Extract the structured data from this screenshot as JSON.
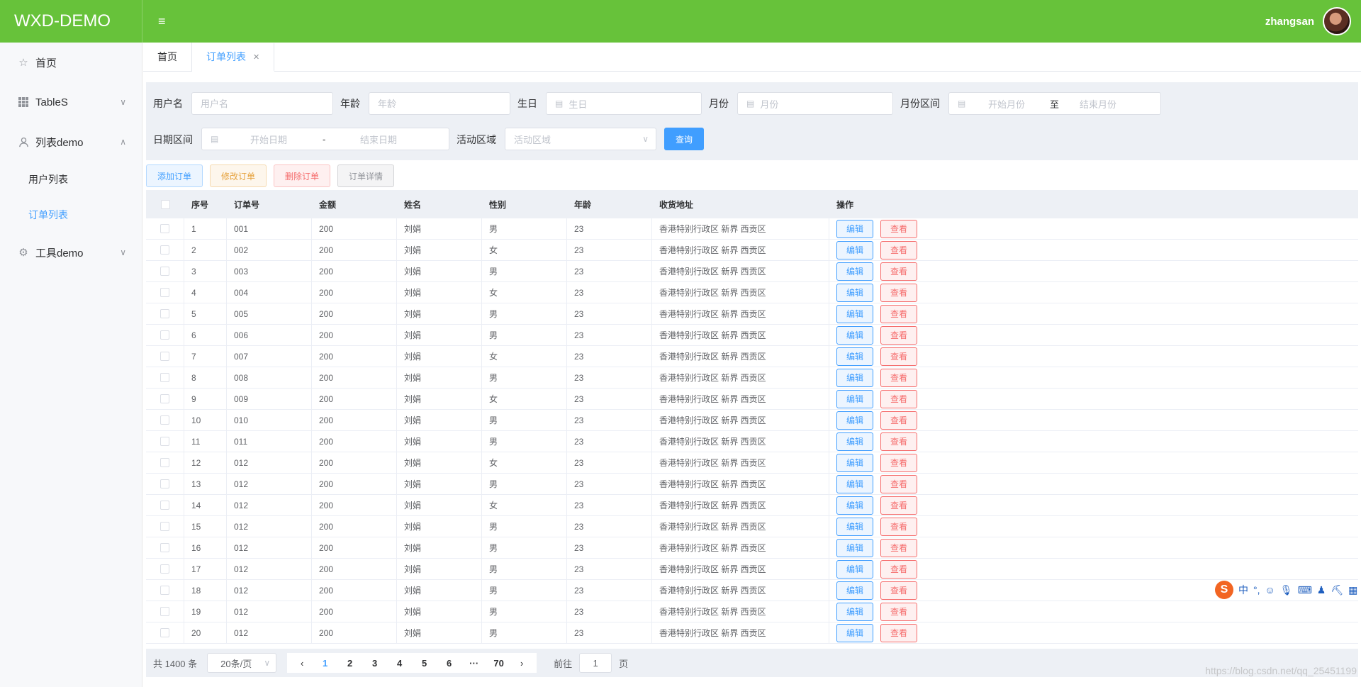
{
  "app": {
    "title": "WXD-DEMO",
    "username": "zhangsan"
  },
  "sidebar": {
    "items": [
      {
        "label": "首页",
        "icon": "star-icon"
      },
      {
        "label": "TableS",
        "icon": "grid-icon"
      },
      {
        "label": "列表demo",
        "icon": "user-icon"
      },
      {
        "label": "工具demo",
        "icon": "gear-icon"
      }
    ],
    "sub": [
      "用户列表",
      "订单列表"
    ]
  },
  "tabs": [
    "首页",
    "订单列表"
  ],
  "search": {
    "username_label": "用户名",
    "username_ph": "用户名",
    "age_label": "年龄",
    "age_ph": "年龄",
    "birthday_label": "生日",
    "birthday_ph": "生日",
    "month_label": "月份",
    "month_ph": "月份",
    "month_range_label": "月份区间",
    "month_start": "开始月份",
    "month_sep": "至",
    "month_end": "结束月份",
    "date_range_label": "日期区间",
    "date_start": "开始日期",
    "date_sep": "-",
    "date_end": "结束日期",
    "area_label": "活动区域",
    "area_ph": "活动区域",
    "query": "查询"
  },
  "actions": {
    "add": "添加订单",
    "edit": "修改订单",
    "delete": "删除订单",
    "detail": "订单详情"
  },
  "table": {
    "columns": [
      "序号",
      "订单号",
      "金额",
      "姓名",
      "性别",
      "年龄",
      "收货地址",
      "操作"
    ],
    "edit_btn": "编辑",
    "view_btn": "查看",
    "rows": [
      [
        "1",
        "001",
        "200",
        "刘娟",
        "男",
        "23",
        "香港特别行政区 新界 西贡区"
      ],
      [
        "2",
        "002",
        "200",
        "刘娟",
        "女",
        "23",
        "香港特别行政区 新界 西贡区"
      ],
      [
        "3",
        "003",
        "200",
        "刘娟",
        "男",
        "23",
        "香港特别行政区 新界 西贡区"
      ],
      [
        "4",
        "004",
        "200",
        "刘娟",
        "女",
        "23",
        "香港特别行政区 新界 西贡区"
      ],
      [
        "5",
        "005",
        "200",
        "刘娟",
        "男",
        "23",
        "香港特别行政区 新界 西贡区"
      ],
      [
        "6",
        "006",
        "200",
        "刘娟",
        "男",
        "23",
        "香港特别行政区 新界 西贡区"
      ],
      [
        "7",
        "007",
        "200",
        "刘娟",
        "女",
        "23",
        "香港特别行政区 新界 西贡区"
      ],
      [
        "8",
        "008",
        "200",
        "刘娟",
        "男",
        "23",
        "香港特别行政区 新界 西贡区"
      ],
      [
        "9",
        "009",
        "200",
        "刘娟",
        "女",
        "23",
        "香港特别行政区 新界 西贡区"
      ],
      [
        "10",
        "010",
        "200",
        "刘娟",
        "男",
        "23",
        "香港特别行政区 新界 西贡区"
      ],
      [
        "11",
        "011",
        "200",
        "刘娟",
        "男",
        "23",
        "香港特别行政区 新界 西贡区"
      ],
      [
        "12",
        "012",
        "200",
        "刘娟",
        "女",
        "23",
        "香港特别行政区 新界 西贡区"
      ],
      [
        "13",
        "012",
        "200",
        "刘娟",
        "男",
        "23",
        "香港特别行政区 新界 西贡区"
      ],
      [
        "14",
        "012",
        "200",
        "刘娟",
        "女",
        "23",
        "香港特别行政区 新界 西贡区"
      ],
      [
        "15",
        "012",
        "200",
        "刘娟",
        "男",
        "23",
        "香港特别行政区 新界 西贡区"
      ],
      [
        "16",
        "012",
        "200",
        "刘娟",
        "男",
        "23",
        "香港特别行政区 新界 西贡区"
      ],
      [
        "17",
        "012",
        "200",
        "刘娟",
        "男",
        "23",
        "香港特别行政区 新界 西贡区"
      ],
      [
        "18",
        "012",
        "200",
        "刘娟",
        "男",
        "23",
        "香港特别行政区 新界 西贡区"
      ],
      [
        "19",
        "012",
        "200",
        "刘娟",
        "男",
        "23",
        "香港特别行政区 新界 西贡区"
      ],
      [
        "20",
        "012",
        "200",
        "刘娟",
        "男",
        "23",
        "香港特别行政区 新界 西贡区"
      ]
    ]
  },
  "pagination": {
    "total": "共 1400 条",
    "page_size": "20条/页",
    "pages": [
      "1",
      "2",
      "3",
      "4",
      "5",
      "6",
      "···",
      "70"
    ],
    "current": "1",
    "goto_label": "前往",
    "goto_value": "1",
    "goto_suffix": "页"
  },
  "ime": {
    "logo": "S",
    "mode": "中"
  },
  "watermark": "https://blog.csdn.net/qq_25451199",
  "colors": {
    "brand": "#67c23a",
    "primary": "#409eff",
    "danger": "#f56c6c",
    "warning": "#e6a23c"
  }
}
